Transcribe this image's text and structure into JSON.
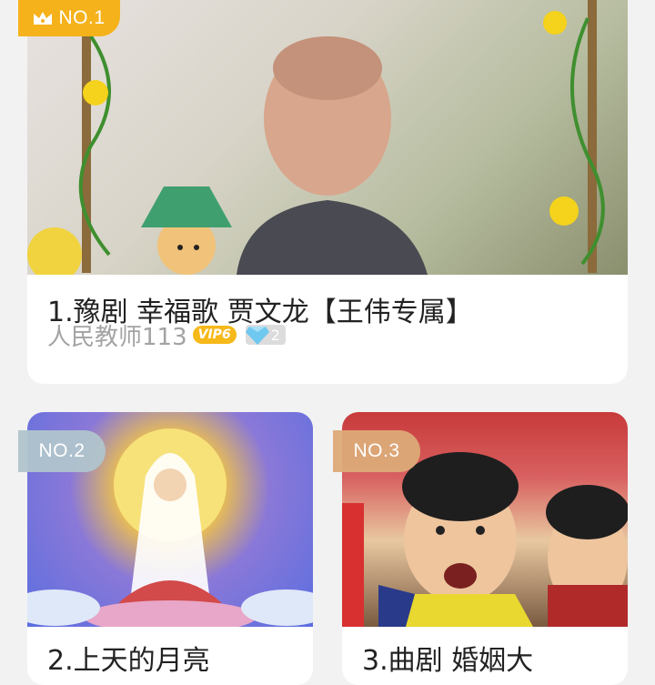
{
  "featured": {
    "rank": "NO.1",
    "title": "1.豫剧 幸福歌 贾文龙【王伟专属】",
    "author": "人民教师113",
    "vip": "VIP6",
    "gem_count": "2"
  },
  "cards": [
    {
      "rank": "NO.2",
      "title": "2.上天的月亮"
    },
    {
      "rank": "NO.3",
      "title": "3.曲剧 婚姻大"
    }
  ],
  "colors": {
    "gold": "#f5b21b",
    "silver": "#b0c4cc",
    "bronze": "#dcaa78"
  }
}
